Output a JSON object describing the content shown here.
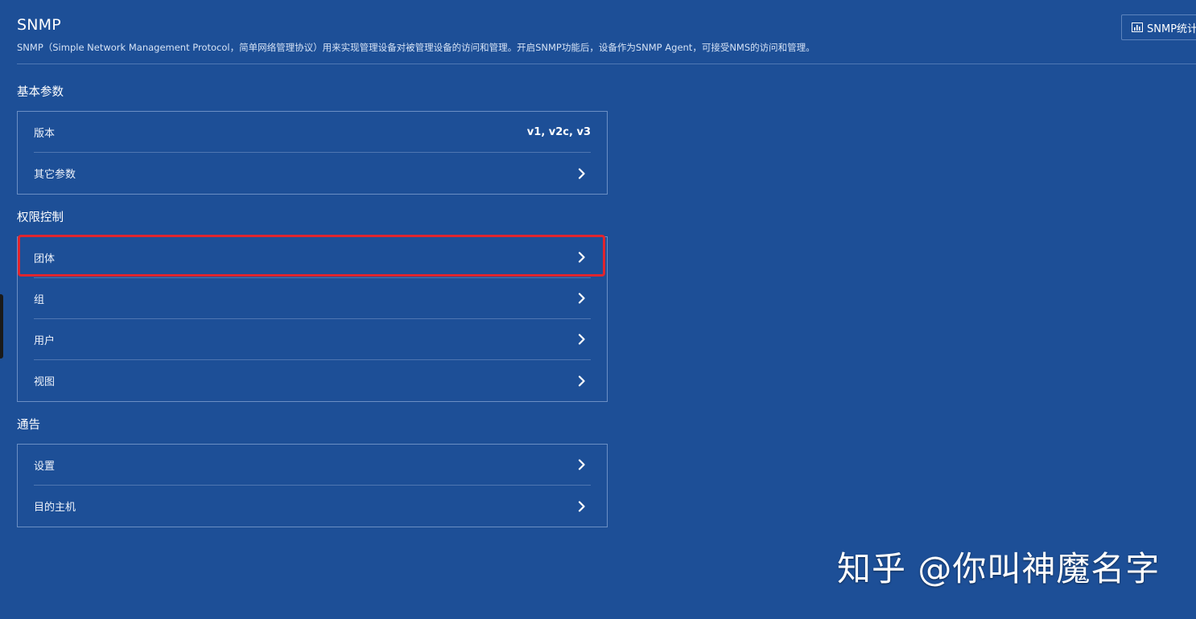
{
  "header": {
    "title": "SNMP",
    "description": "SNMP（Simple Network Management Protocol，简单网络管理协议）用来实现管理设备对被管理设备的访问和管理。开启SNMP功能后，设备作为SNMP Agent，可接受NMS的访问和管理。",
    "stats_button_label": "SNMP统计"
  },
  "sections": {
    "basic": {
      "title": "基本参数",
      "rows": [
        {
          "label": "版本",
          "value": "v1, v2c, v3"
        },
        {
          "label": "其它参数"
        }
      ]
    },
    "access": {
      "title": "权限控制",
      "rows": [
        {
          "label": "团体"
        },
        {
          "label": "组"
        },
        {
          "label": "用户"
        },
        {
          "label": "视图"
        }
      ]
    },
    "notify": {
      "title": "通告",
      "rows": [
        {
          "label": "设置"
        },
        {
          "label": "目的主机"
        }
      ]
    }
  },
  "watermark": "知乎 @你叫神魔名字",
  "colors": {
    "background": "#1d4f97",
    "card_border": "#6b8fc4",
    "highlight": "#e0252e"
  }
}
